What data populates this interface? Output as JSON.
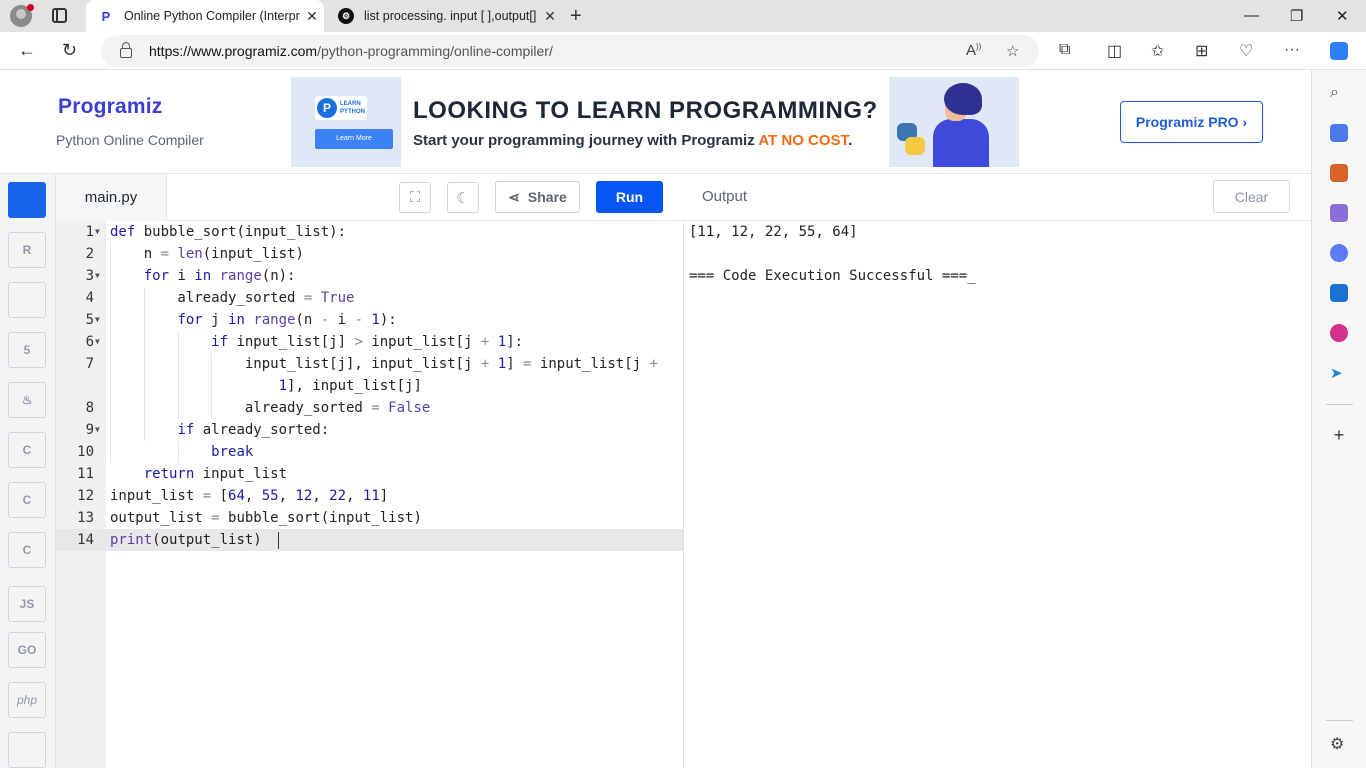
{
  "browser": {
    "tabs": [
      {
        "title": "Online Python Compiler (Interpre",
        "favicon": "P",
        "active": true
      },
      {
        "title": "list processing. input [ ],output[]",
        "favicon": "⚙",
        "active": false
      }
    ],
    "new_tab": "+",
    "url_domain": "https://www.programiz.com",
    "url_path": "/python-programming/online-compiler/"
  },
  "header": {
    "logo": "Programiz",
    "subtitle": "Python Online Compiler",
    "pro_button": "Programiz PRO ›"
  },
  "banner": {
    "badge_line1": "LEARN",
    "badge_line2": "PYTHON",
    "learn_more": "Learn More",
    "headline": "LOOKING TO LEARN PROGRAMMING?",
    "sub_start": "Start your programming journey with Programiz ",
    "sub_highlight": "AT NO COST",
    "sub_end": "."
  },
  "languages": [
    {
      "name": "python-icon",
      "label": "",
      "active": true
    },
    {
      "name": "r-icon",
      "label": "R",
      "active": false
    },
    {
      "name": "sql-icon",
      "label": "",
      "active": false
    },
    {
      "name": "html-icon",
      "label": "5",
      "active": false
    },
    {
      "name": "java-icon",
      "label": "♨",
      "active": false
    },
    {
      "name": "c-icon",
      "label": "C",
      "active": false
    },
    {
      "name": "cpp-icon",
      "label": "C",
      "active": false
    },
    {
      "name": "csharp-icon",
      "label": "C",
      "active": false
    },
    {
      "name": "js-icon",
      "label": "JS",
      "active": false
    },
    {
      "name": "go-icon",
      "label": "GO",
      "active": false
    },
    {
      "name": "php-icon",
      "label": "php",
      "active": false
    },
    {
      "name": "swift-icon",
      "label": "",
      "active": false
    }
  ],
  "editor": {
    "file_name": "main.py",
    "share_label": "Share",
    "run_label": "Run",
    "line_numbers": [
      "1",
      "2",
      "3",
      "4",
      "5",
      "6",
      "7",
      "",
      "8",
      "9",
      "10",
      "11",
      "12",
      "13",
      "14"
    ]
  },
  "output": {
    "title": "Output",
    "clear_label": "Clear",
    "lines": [
      "[11, 12, 22, 55, 64]",
      "",
      "=== Code Execution Successful ===_"
    ]
  },
  "colors": {
    "accent": "#0556f3",
    "brand": "#3b3ed1",
    "highlight": "#f36b14"
  }
}
